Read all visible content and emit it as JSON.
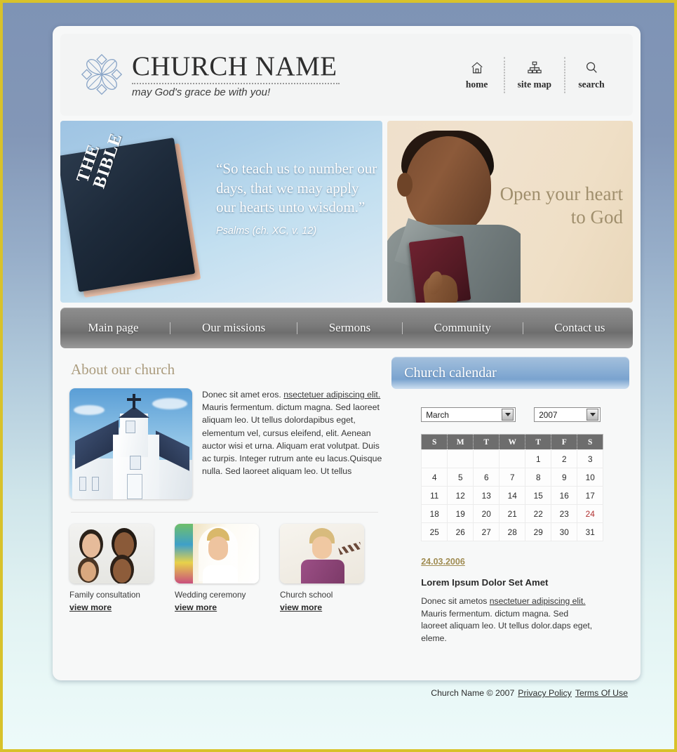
{
  "header": {
    "logo_icon": "church-flower-logo",
    "title": "CHURCH NAME",
    "tagline": "may God's grace be with you!",
    "nav": [
      {
        "icon": "home-icon",
        "label": "home"
      },
      {
        "icon": "sitemap-icon",
        "label": "site map"
      },
      {
        "icon": "search-icon",
        "label": "search"
      }
    ]
  },
  "banner_left": {
    "book_label": "THE\nBIBLE",
    "quote": "“So teach us to number our days, that we may apply our hearts unto wisdom.”",
    "source": "Psalms (ch. XC, v. 12)"
  },
  "banner_right": {
    "headline": "Open your heart to God",
    "image_alt": "man-kissing-bible-photo"
  },
  "mainnav": {
    "items": [
      {
        "label": "Main page"
      },
      {
        "label": "Our missions"
      },
      {
        "label": "Sermons"
      },
      {
        "label": "Community"
      },
      {
        "label": "Contact us"
      }
    ]
  },
  "about": {
    "title": "About our church",
    "photo_alt": "white-church-photo",
    "text_before": "Donec sit amet eros. ",
    "link": "nsectetuer adipiscing elit.",
    "text_after": " Mauris fermentum. dictum magna. Sed laoreet aliquam leo. Ut tellus dolordapibus eget, elementum vel, cursus eleifend, elit. Aenean auctor wisi et urna. Aliquam erat volutpat. Duis ac turpis. Integer rutrum ante eu lacus.Quisque nulla. Sed laoreet aliquam leo. Ut tellus"
  },
  "thumbs": [
    {
      "caption": "Family consultation",
      "link": "view more",
      "image_alt": "family-photo"
    },
    {
      "caption": "Wedding ceremony",
      "link": "view more",
      "image_alt": "bride-photo"
    },
    {
      "caption": "Church school",
      "link": "view more",
      "image_alt": "girl-photo"
    }
  ],
  "calendar": {
    "title": "Church calendar",
    "month": "March",
    "year": "2007",
    "weekdays": [
      "S",
      "M",
      "T",
      "W",
      "T",
      "F",
      "S"
    ],
    "weeks": [
      [
        "",
        "",
        "",
        "",
        "1",
        "2",
        "3"
      ],
      [
        "4",
        "5",
        "6",
        "7",
        "8",
        "9",
        "10"
      ],
      [
        "11",
        "12",
        "13",
        "14",
        "15",
        "16",
        "17"
      ],
      [
        "18",
        "19",
        "20",
        "21",
        "22",
        "23",
        "24"
      ],
      [
        "25",
        "26",
        "27",
        "28",
        "29",
        "30",
        "31"
      ]
    ],
    "highlighted_day": "24",
    "highlight_color": "#b03030"
  },
  "news": {
    "date": "24.03.2006",
    "title": "Lorem Ipsum Dolor Set Amet",
    "text_before": "Donec sit ametos ",
    "link": "nsectetuer adipiscing elit.",
    "text_after": " Mauris fermentum. dictum magna. Sed laoreet aliquam leo. Ut tellus dolor.daps eget, eleme."
  },
  "footer": {
    "copyright": "Church Name © 2007",
    "links": [
      {
        "label": "Privacy Policy"
      },
      {
        "label": "Terms Of Use"
      }
    ]
  },
  "colors": {
    "page_bg_top": "#7e93b5",
    "page_bg_bottom": "#edfafa",
    "frame_border": "#d8c22b",
    "section_title": "#ab9c7e",
    "news_date": "#a08c52",
    "calendar_header": "#6d6d6d",
    "banner_right_text": "#a08f6d"
  }
}
